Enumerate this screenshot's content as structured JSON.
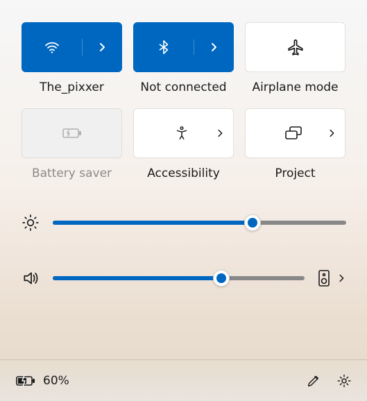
{
  "tiles": {
    "wifi": {
      "label": "The_pixxer"
    },
    "bluetooth": {
      "label": "Not connected"
    },
    "airplane": {
      "label": "Airplane mode"
    },
    "battery_saver": {
      "label": "Battery saver"
    },
    "accessibility": {
      "label": "Accessibility"
    },
    "project": {
      "label": "Project"
    }
  },
  "sliders": {
    "brightness": {
      "percent": 68
    },
    "volume": {
      "percent": 67
    }
  },
  "status": {
    "battery_percent": "60%"
  }
}
